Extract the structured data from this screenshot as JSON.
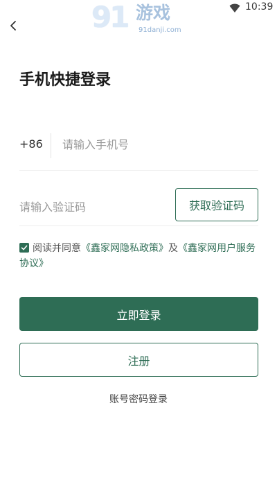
{
  "status_bar": {
    "time": "10:39",
    "wifi_icon": "wifi-icon"
  },
  "watermark": {
    "logo_text": "91",
    "brand_text": "游戏",
    "url_text": "91danji.com"
  },
  "header": {
    "back_icon": "chevron-left-icon"
  },
  "title": "手机快捷登录",
  "phone": {
    "country_code": "+86",
    "placeholder": "请输入手机号",
    "value": ""
  },
  "code": {
    "placeholder": "请输入验证码",
    "value": "",
    "get_code_label": "获取验证码"
  },
  "agreement": {
    "checked": true,
    "prefix": "阅读并同意",
    "privacy_link": "《鑫家网隐私政策》",
    "connector": "及",
    "service_link": "《鑫家网用户服务协议》"
  },
  "buttons": {
    "login": "立即登录",
    "register": "注册",
    "password_login": "账号密码登录"
  },
  "colors": {
    "brand_green": "#2e6d55",
    "text_dark": "#1a1a1a",
    "placeholder": "#999999",
    "divider": "#eeeeee"
  }
}
